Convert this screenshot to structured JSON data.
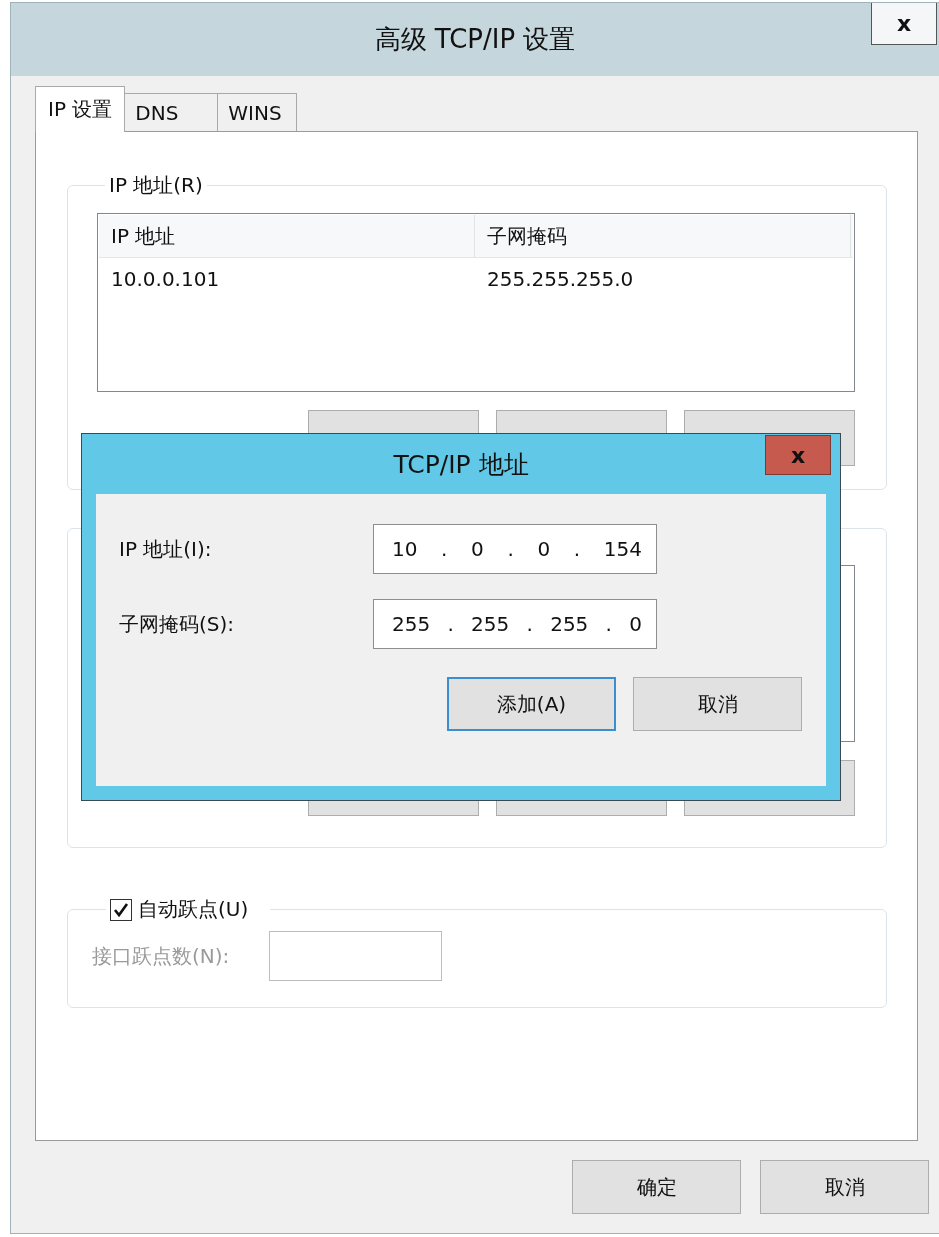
{
  "window": {
    "title": "高级 TCP/IP 设置",
    "close": "x"
  },
  "tabs": [
    {
      "label": "IP 设置",
      "selected": true
    },
    {
      "label": "DNS",
      "selected": false
    },
    {
      "label": "WINS",
      "selected": false
    }
  ],
  "ip_group": {
    "legend": "IP 地址(R)",
    "columns": [
      "IP 地址",
      "子网掩码"
    ],
    "rows": [
      [
        "10.0.0.101",
        "255.255.255.0"
      ]
    ]
  },
  "auto_metric": {
    "label": "自动跃点(U)",
    "checked": true
  },
  "interface_metric": {
    "label": "接口跃点数(N):",
    "disabled": true
  },
  "buttons": [
    "确定",
    "取消"
  ],
  "dialog": {
    "title": "TCP/IP 地址",
    "close": "x",
    "separator": ".",
    "fields": [
      {
        "label": "IP 地址(I):",
        "octets": [
          "10",
          "0",
          "0",
          "154"
        ]
      },
      {
        "label": "子网掩码(S):",
        "octets": [
          "255",
          "255",
          "255",
          "0"
        ]
      }
    ],
    "buttons": [
      {
        "label": "添加(A)",
        "default": true
      },
      {
        "label": "取消",
        "default": false
      }
    ]
  }
}
